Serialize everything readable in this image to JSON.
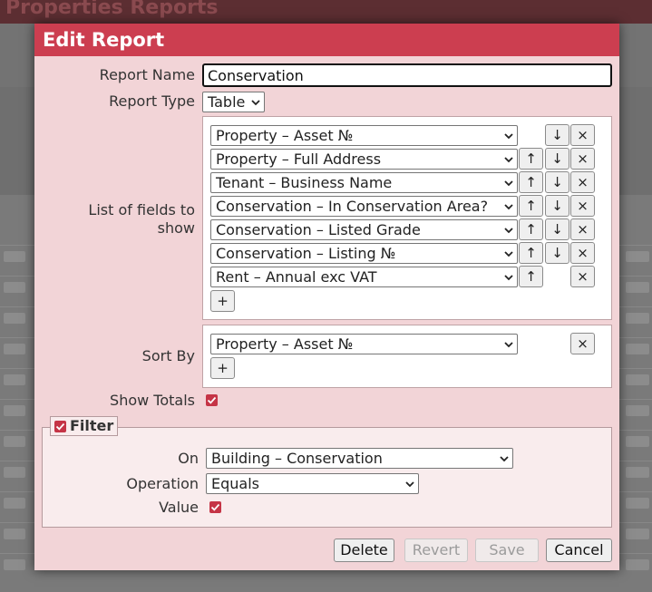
{
  "background": {
    "title": "Properties Reports"
  },
  "dialog": {
    "title": "Edit Report",
    "report_name_label": "Report Name",
    "report_name_value": "Conservation",
    "report_type_label": "Report Type",
    "report_type_value": "Table",
    "fields_label": "List of fields to show",
    "fields": [
      "Property – Asset №",
      "Property – Full Address",
      "Tenant – Business Name",
      "Conservation – In Conservation Area?",
      "Conservation – Listed Grade",
      "Conservation – Listing №",
      "Rent – Annual exc VAT"
    ],
    "sort_by_label": "Sort By",
    "sort_by_value": "Property – Asset №",
    "show_totals_label": "Show Totals",
    "show_totals_checked": true,
    "add_symbol": "+",
    "up_symbol": "↑",
    "down_symbol": "↓",
    "remove_symbol": "×",
    "filter": {
      "legend": "Filter",
      "enabled": true,
      "on_label": "On",
      "on_value": "Building – Conservation",
      "operation_label": "Operation",
      "operation_value": "Equals",
      "value_label": "Value",
      "value_checked": true
    },
    "buttons": {
      "delete": "Delete",
      "revert": "Revert",
      "save": "Save",
      "cancel": "Cancel"
    },
    "accent_color": "#cc3e50"
  }
}
